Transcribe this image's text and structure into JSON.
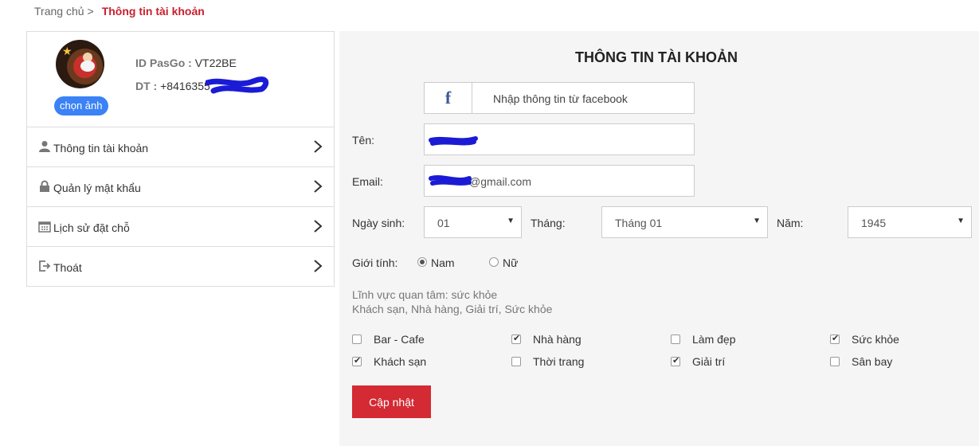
{
  "breadcrumb": {
    "home": "Trang chủ",
    "separator": ">",
    "current": "Thông tin tài khoản"
  },
  "profile": {
    "choose_photo": "chọn ảnh",
    "id_label": "ID PasGo :",
    "id_value": "VT22BE",
    "phone_label": "DT :",
    "phone_value": "+8416355"
  },
  "menu": [
    {
      "label": "Thông tin tài khoản",
      "icon": "user-icon"
    },
    {
      "label": "Quản lý mật khẩu",
      "icon": "lock-icon"
    },
    {
      "label": "Lịch sử đặt chỗ",
      "icon": "calendar-icon"
    },
    {
      "label": "Thoát",
      "icon": "logout-icon"
    }
  ],
  "form": {
    "title": "THÔNG TIN TÀI KHOẢN",
    "facebook_icon": "f",
    "facebook_label": "Nhập thông tin từ facebook",
    "name_label": "Tên:",
    "name_value": "",
    "email_label": "Email:",
    "email_value": "@gmail.com",
    "dob_label": "Ngày sinh:",
    "day_value": "01",
    "month_label": "Tháng:",
    "month_value": "Tháng 01",
    "year_label": "Năm:",
    "year_value": "1945",
    "gender_label": "Giới tính:",
    "gender_male": "Nam",
    "gender_female": "Nữ",
    "interest_line1": "Lĩnh vực quan tâm: sức khỏe",
    "interest_line2": "Khách sạn, Nhà hàng, Giải trí, Sức khỏe",
    "interests": [
      {
        "label": "Bar - Cafe",
        "checked": false
      },
      {
        "label": "Nhà hàng",
        "checked": true
      },
      {
        "label": "Làm đẹp",
        "checked": false
      },
      {
        "label": "Sức khỏe",
        "checked": true
      },
      {
        "label": "Khách sạn",
        "checked": true
      },
      {
        "label": "Thời trang",
        "checked": false
      },
      {
        "label": "Giải trí",
        "checked": true
      },
      {
        "label": "Sân bay",
        "checked": false
      }
    ],
    "update_button": "Cập nhật"
  },
  "colors": {
    "accent": "#c8202f",
    "button_blue": "#3b82f6",
    "facebook": "#3b5998"
  }
}
